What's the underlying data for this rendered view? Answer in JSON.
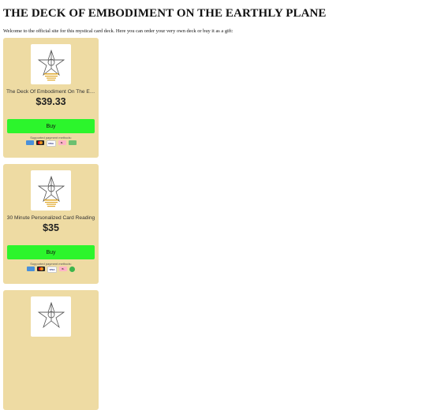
{
  "page": {
    "title": "THE DECK OF EMBODIMENT ON THE EARTHLY PLANE",
    "intro": "Welcome to the official site for this mystical card deck. Here you can order your very own deck or buy it as a gift:"
  },
  "products": [
    {
      "name": "The Deck Of Embodiment On The Earthly Plane",
      "price": "$39.33",
      "buy_label": "Buy",
      "payment_caption": "Supported payment methods:",
      "payment_icons": [
        "card-icon",
        "mastercard-icon",
        "visa-icon",
        "klarna-icon",
        "cash-icon"
      ]
    },
    {
      "name": "30 Minute Personalized Card Reading",
      "price": "$35",
      "buy_label": "Buy",
      "payment_caption": "Supported payment methods:",
      "payment_icons": [
        "card-icon",
        "mastercard-icon",
        "visa-icon",
        "klarna-icon",
        "cashapp-icon"
      ]
    },
    {
      "name": "",
      "price": "",
      "buy_label": "",
      "payment_caption": ""
    }
  ],
  "colors": {
    "card_bg": "#eedba3",
    "buy_button": "#2cf52c",
    "logo_gold": "#e0a82a"
  },
  "payment_text": {
    "visa": "VISA",
    "klarna": "K."
  }
}
